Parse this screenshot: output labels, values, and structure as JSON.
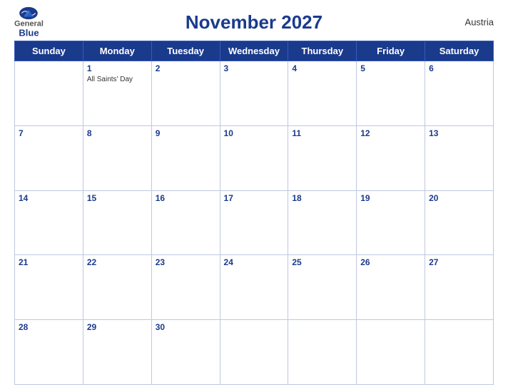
{
  "header": {
    "title": "November 2027",
    "country": "Austria",
    "logo_general": "General",
    "logo_blue": "Blue"
  },
  "weekdays": [
    "Sunday",
    "Monday",
    "Tuesday",
    "Wednesday",
    "Thursday",
    "Friday",
    "Saturday"
  ],
  "weeks": [
    [
      {
        "day": "",
        "empty": true
      },
      {
        "day": "1",
        "event": "All Saints' Day"
      },
      {
        "day": "2",
        "event": ""
      },
      {
        "day": "3",
        "event": ""
      },
      {
        "day": "4",
        "event": ""
      },
      {
        "day": "5",
        "event": ""
      },
      {
        "day": "6",
        "event": ""
      }
    ],
    [
      {
        "day": "7",
        "event": ""
      },
      {
        "day": "8",
        "event": ""
      },
      {
        "day": "9",
        "event": ""
      },
      {
        "day": "10",
        "event": ""
      },
      {
        "day": "11",
        "event": ""
      },
      {
        "day": "12",
        "event": ""
      },
      {
        "day": "13",
        "event": ""
      }
    ],
    [
      {
        "day": "14",
        "event": ""
      },
      {
        "day": "15",
        "event": ""
      },
      {
        "day": "16",
        "event": ""
      },
      {
        "day": "17",
        "event": ""
      },
      {
        "day": "18",
        "event": ""
      },
      {
        "day": "19",
        "event": ""
      },
      {
        "day": "20",
        "event": ""
      }
    ],
    [
      {
        "day": "21",
        "event": ""
      },
      {
        "day": "22",
        "event": ""
      },
      {
        "day": "23",
        "event": ""
      },
      {
        "day": "24",
        "event": ""
      },
      {
        "day": "25",
        "event": ""
      },
      {
        "day": "26",
        "event": ""
      },
      {
        "day": "27",
        "event": ""
      }
    ],
    [
      {
        "day": "28",
        "event": ""
      },
      {
        "day": "29",
        "event": ""
      },
      {
        "day": "30",
        "event": ""
      },
      {
        "day": "",
        "empty": true
      },
      {
        "day": "",
        "empty": true
      },
      {
        "day": "",
        "empty": true
      },
      {
        "day": "",
        "empty": true
      }
    ]
  ]
}
